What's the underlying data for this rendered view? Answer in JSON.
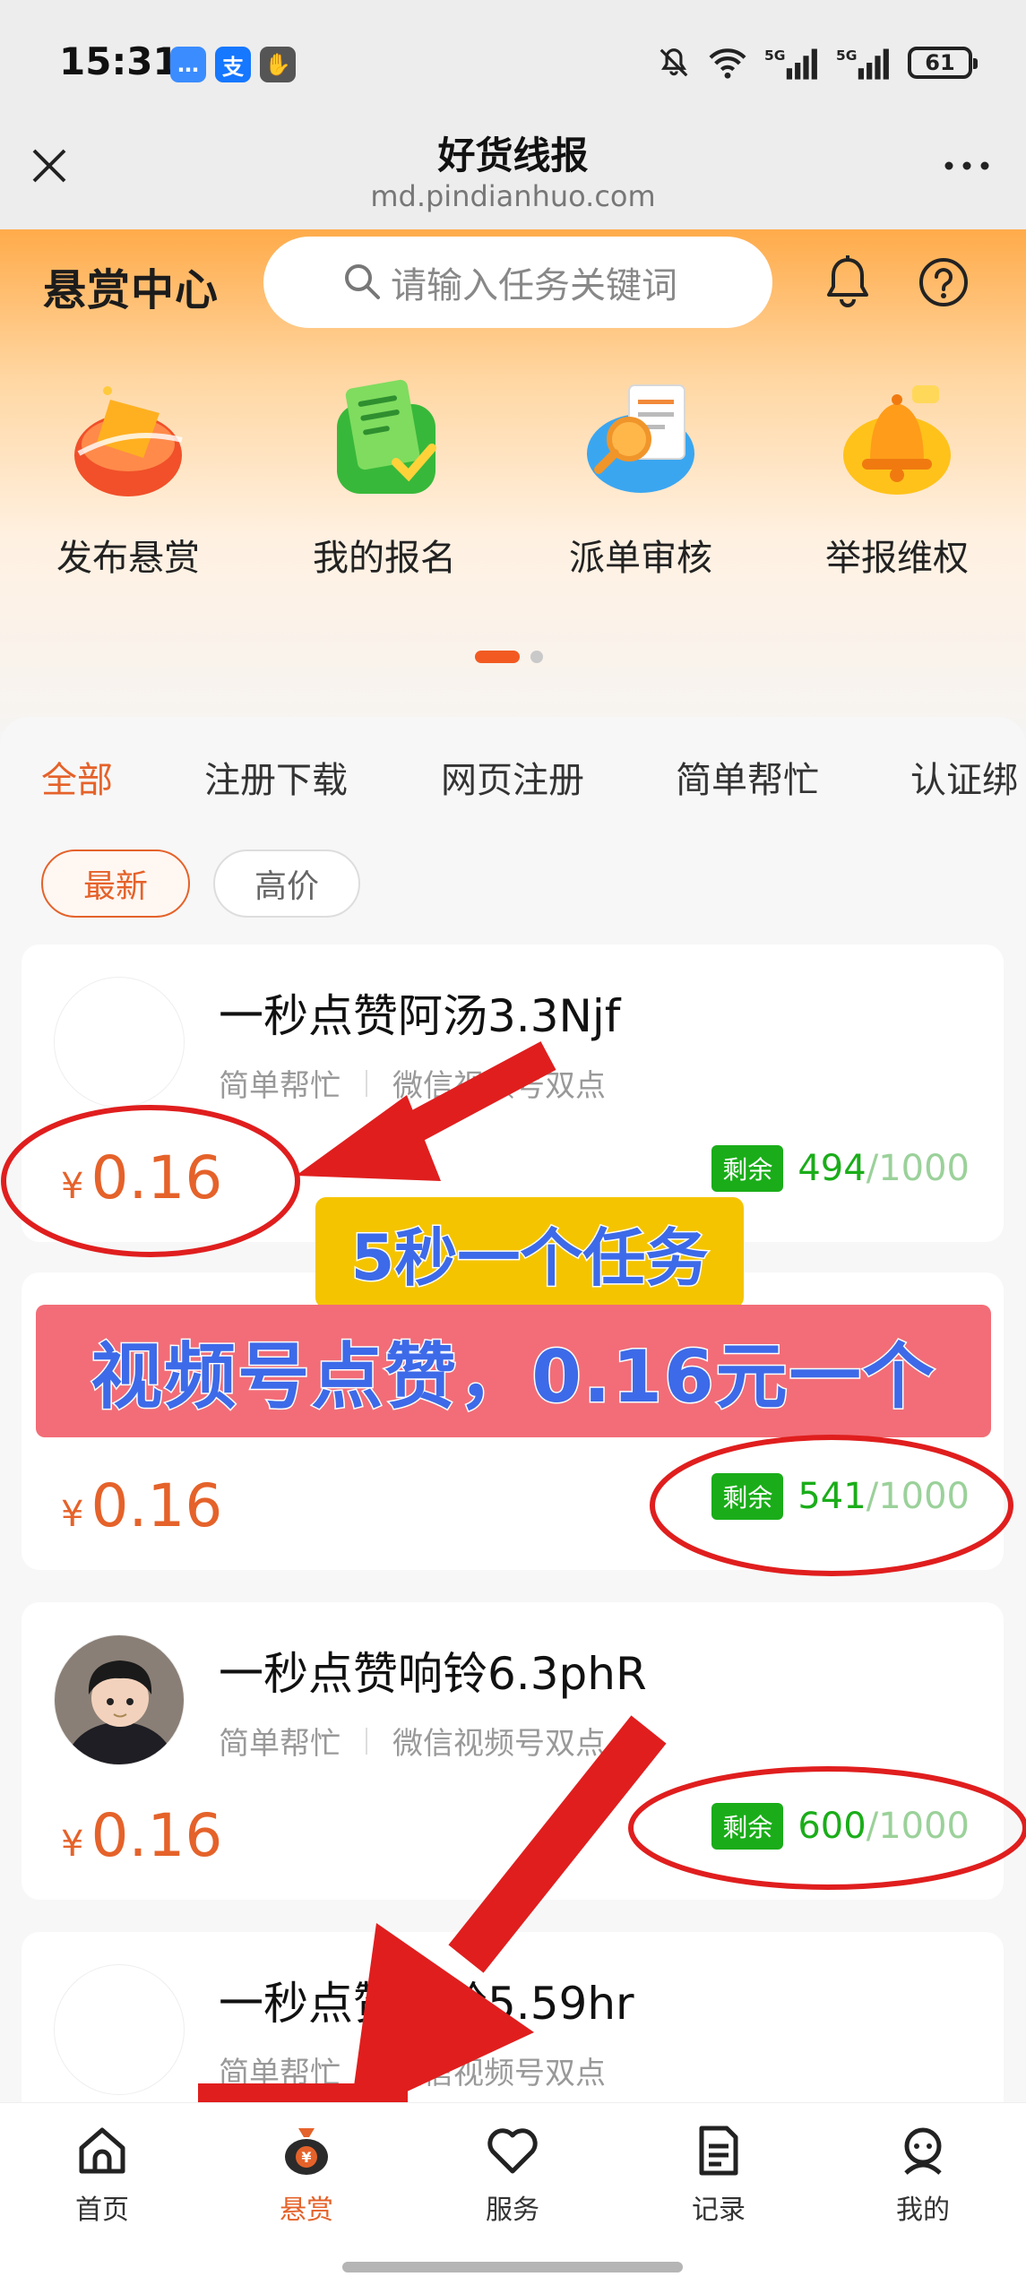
{
  "status_bar": {
    "time": "15:31",
    "apps": [
      {
        "name": "message-app",
        "glyph": "…",
        "color": "#3b8cff"
      },
      {
        "name": "alipay-app",
        "glyph": "支",
        "color": "#1677ff"
      },
      {
        "name": "gesture-app",
        "glyph": "✋",
        "color": "#555555"
      }
    ],
    "battery": "61",
    "network": [
      "5G",
      "5G"
    ]
  },
  "browser": {
    "title": "好货线报",
    "url": "md.pindianhuo.com"
  },
  "header": {
    "title": "悬赏中心",
    "search_placeholder": "请输入任务关键词"
  },
  "features": [
    {
      "label": "发布悬赏",
      "icon": "publish-reward-icon"
    },
    {
      "label": "我的报名",
      "icon": "my-signup-icon"
    },
    {
      "label": "派单审核",
      "icon": "dispatch-review-icon"
    },
    {
      "label": "举报维权",
      "icon": "report-icon"
    }
  ],
  "category_tabs": [
    "全部",
    "注册下载",
    "网页注册",
    "简单帮忙",
    "认证绑"
  ],
  "active_category": "全部",
  "sort_options": [
    "最新",
    "高价"
  ],
  "active_sort": "最新",
  "tasks": [
    {
      "title": "一秒点赞阿汤3.3Njf",
      "category": "简单帮忙",
      "subcategory": "微信视频号双点",
      "currency": "¥",
      "price": "0.16",
      "remain_label": "剩余",
      "remain": "494",
      "total": "/1000"
    },
    {
      "title": "",
      "category": "",
      "subcategory": "",
      "currency": "¥",
      "price": "0.16",
      "remain_label": "剩余",
      "remain": "541",
      "total": "/1000"
    },
    {
      "title": "一秒点赞响铃6.3phR",
      "category": "简单帮忙",
      "subcategory": "微信视频号双点",
      "currency": "¥",
      "price": "0.16",
      "remain_label": "剩余",
      "remain": "600",
      "total": "/1000"
    },
    {
      "title": "一秒点赞响铃5.59hr",
      "category": "简单帮忙",
      "subcategory": "微信视频号双点",
      "currency": "¥",
      "price": "",
      "remain_label": "",
      "remain": "",
      "total": ""
    }
  ],
  "annotations": {
    "banner_top": "5秒一个任务",
    "banner_main": "视频号点赞，0.16元一个"
  },
  "bottom_nav": [
    {
      "label": "首页",
      "icon": "home-icon"
    },
    {
      "label": "悬赏",
      "icon": "money-bag-icon"
    },
    {
      "label": "服务",
      "icon": "heart-icon"
    },
    {
      "label": "记录",
      "icon": "record-icon"
    },
    {
      "label": "我的",
      "icon": "profile-icon"
    }
  ],
  "active_nav": "悬赏",
  "colors": {
    "accent": "#e5622a",
    "remain_green": "#1aad19",
    "annotation_red": "#e01e1e"
  }
}
